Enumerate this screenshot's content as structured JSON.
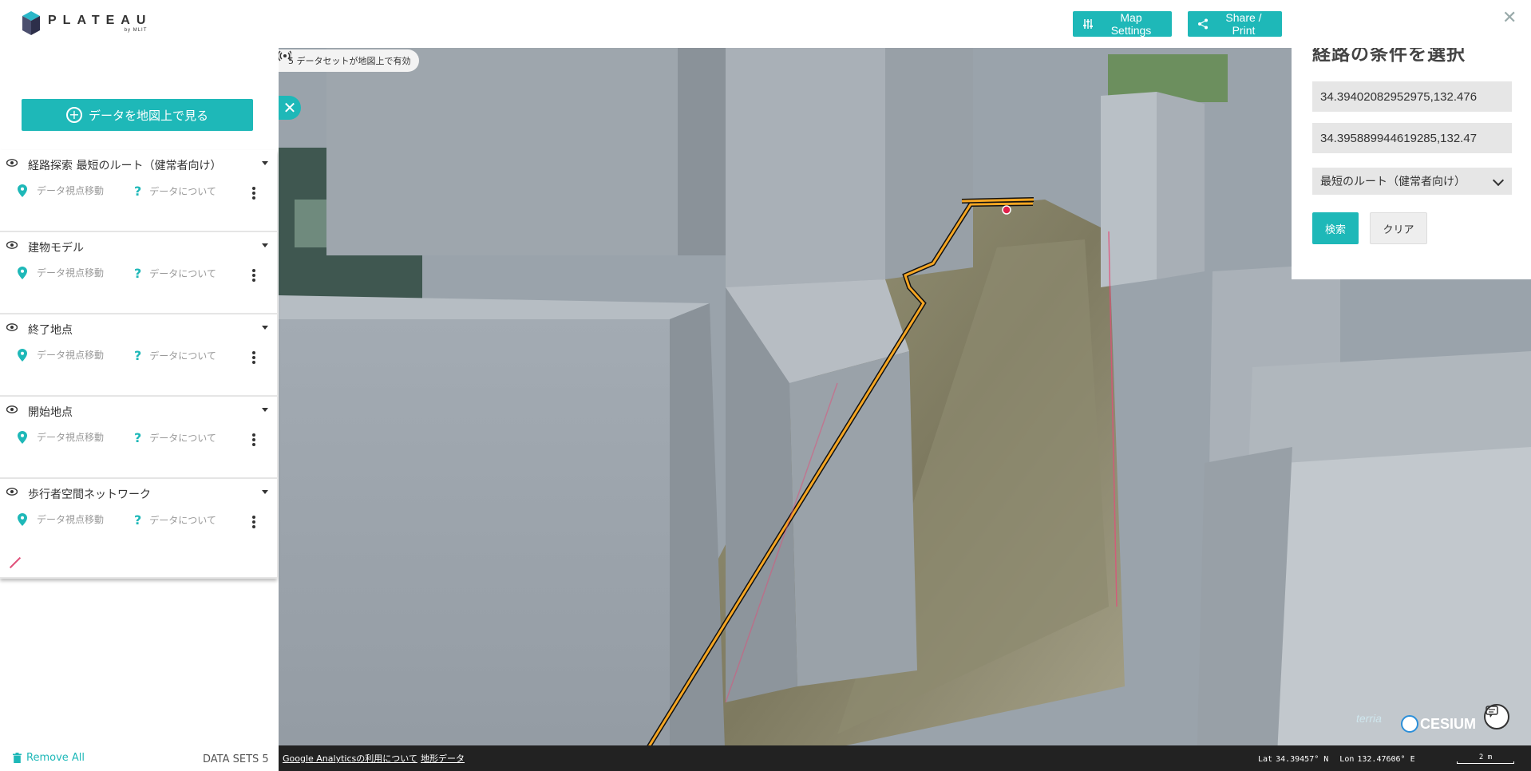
{
  "header": {
    "logo_main": "PLATEAU",
    "logo_sub": "by MLIT",
    "map_settings_label": "Map Settings",
    "share_label": "Share / Print"
  },
  "sidebar": {
    "add_data_label": "データを地図上で見る",
    "datasets": [
      {
        "title": "経路探索 最短のルート（健常者向け）",
        "move_label": "データ視点移動",
        "about_label": "データについて"
      },
      {
        "title": "建物モデル",
        "move_label": "データ視点移動",
        "about_label": "データについて"
      },
      {
        "title": "終了地点",
        "move_label": "データ視点移動",
        "about_label": "データについて"
      },
      {
        "title": "開始地点",
        "move_label": "データ視点移動",
        "about_label": "データについて"
      },
      {
        "title": "歩行者空間ネットワーク",
        "move_label": "データ視点移動",
        "about_label": "データについて"
      }
    ],
    "remove_all_label": "Remove All",
    "dataset_count_label": "DATA SETS 5"
  },
  "map": {
    "badge_text": "5 データセットが地図上で有効",
    "footer": {
      "ga_link": "Google Analyticsの利用について",
      "terrain_link": "地形データ",
      "lat_label": "Lat",
      "lat_value": "34.39457° N",
      "lon_label": "Lon",
      "lon_value": "132.47606° E",
      "scale_label": "2 m"
    },
    "terria_text": "terria",
    "cesium_text": "CESIUM"
  },
  "route_panel": {
    "title": "経路の条件を選択",
    "start_value": "34.39402082952975,132.476",
    "end_value": "34.395889944619285,132.47",
    "route_type": "最短のルート（健常者向け）",
    "search_label": "検索",
    "clear_label": "クリア"
  },
  "colors": {
    "accent": "#1eb8b8",
    "route": "#f5a623",
    "building": "#9aa3ab"
  }
}
